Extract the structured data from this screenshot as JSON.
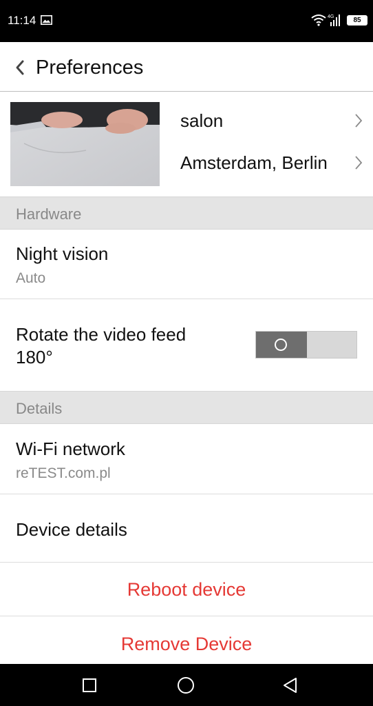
{
  "status_bar": {
    "time": "11:14",
    "battery": "85",
    "icons": [
      "gallery-icon",
      "wifi-icon",
      "mobile-signal-icon",
      "battery-icon"
    ]
  },
  "header": {
    "title": "Preferences",
    "back_icon": "chevron-left-icon"
  },
  "camera": {
    "name": "salon",
    "location": "Amsterdam, Berlin"
  },
  "sections": {
    "hardware": "Hardware",
    "details": "Details"
  },
  "night_vision": {
    "title": "Night vision",
    "value": "Auto"
  },
  "rotate": {
    "title_line1": "Rotate the video feed",
    "title_line2": "180°",
    "enabled": false
  },
  "wifi": {
    "title": "Wi-Fi network",
    "value": "reTEST.com.pl"
  },
  "device_details": {
    "title": "Device details"
  },
  "actions": {
    "reboot": "Reboot device",
    "remove": "Remove Device"
  },
  "colors": {
    "danger": "#e53935",
    "section_bg": "#e4e4e4",
    "muted_text": "#8a8a8a",
    "toggle_knob": "#6e6e6e"
  },
  "nav_bar": {
    "icons": [
      "recents-square-icon",
      "home-circle-icon",
      "back-triangle-icon"
    ]
  }
}
